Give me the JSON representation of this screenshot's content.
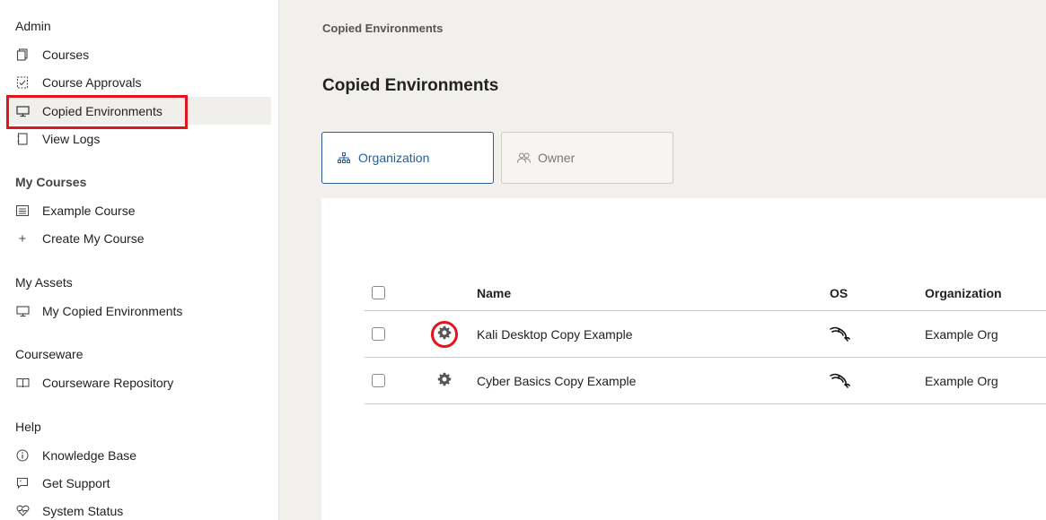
{
  "sidebar": {
    "sections": [
      {
        "title": "Admin"
      },
      {
        "title": "My Courses"
      },
      {
        "title": "My Assets"
      },
      {
        "title": "Courseware"
      },
      {
        "title": "Help"
      }
    ],
    "admin_items": [
      "Courses",
      "Course Approvals",
      "Copied Environments",
      "View Logs"
    ],
    "mycourses_items": [
      "Example Course",
      "Create My Course"
    ],
    "myassets_items": [
      "My Copied Environments"
    ],
    "courseware_items": [
      "Courseware Repository"
    ],
    "help_items": [
      "Knowledge Base",
      "Get Support",
      "System Status"
    ],
    "active_item": "Copied Environments"
  },
  "main": {
    "breadcrumb": "Copied Environments",
    "title": "Copied Environments",
    "tabs": [
      {
        "label": "Organization",
        "icon": "hierarchy-icon",
        "active": true
      },
      {
        "label": "Owner",
        "icon": "users-icon",
        "active": false
      }
    ]
  },
  "table": {
    "columns": {
      "name": "Name",
      "os": "OS",
      "organization": "Organization"
    },
    "rows": [
      {
        "name": "Kali Desktop Copy Example",
        "os_icon": "kali-dragon-icon",
        "organization": "Example Org",
        "highlighted": true
      },
      {
        "name": "Cyber Basics Copy Example",
        "os_icon": "kali-dragon-icon",
        "organization": "Example Org",
        "highlighted": false
      }
    ]
  },
  "colors": {
    "accent": "#2c5d96",
    "highlight": "#e3151a",
    "main_bg": "#f1f0ec"
  }
}
